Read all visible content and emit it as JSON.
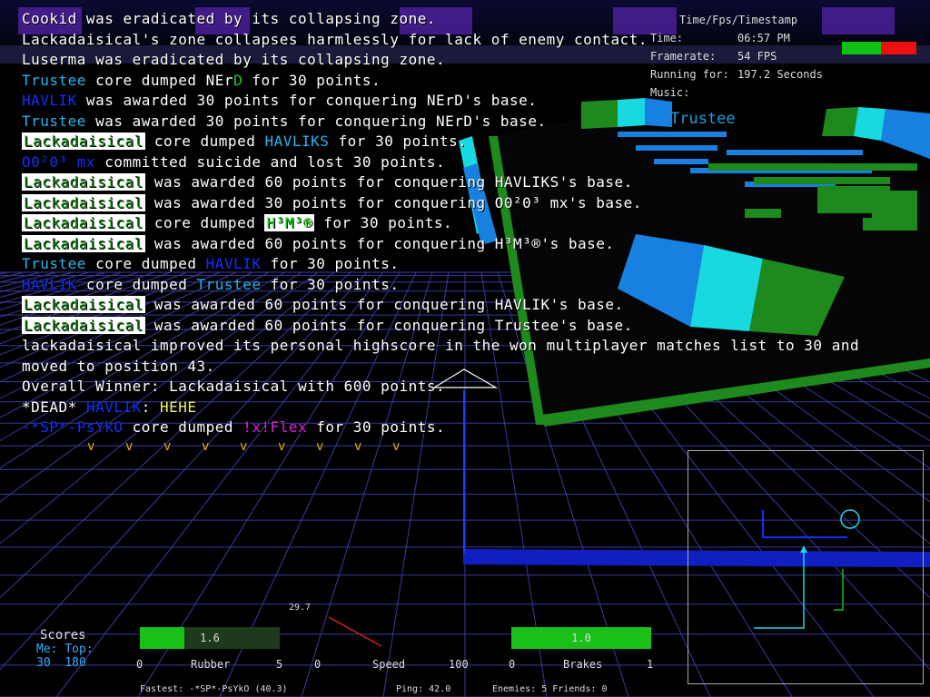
{
  "console_lines": [
    [
      {
        "t": "Cookid was eradicated by its collapsing zone.",
        "c": "#ffffff"
      }
    ],
    [
      {
        "t": "Lackadaisical's zone collapses harmlessly for lack of enemy contact.",
        "c": "#ffffff"
      }
    ],
    [
      {
        "t": "Luserma was eradicated by its collapsing zone.",
        "c": "#ffffff"
      }
    ],
    [
      {
        "t": "Trustee",
        "c": "#28b4f0"
      },
      {
        "t": " core dumped NEr",
        "c": "#ffffff"
      },
      {
        "t": "D",
        "c": "#18d018"
      },
      {
        "t": " for 30 points.",
        "c": "#ffffff"
      }
    ],
    [
      {
        "t": "HAVLIK",
        "c": "#1030ff"
      },
      {
        "t": " was awarded 30 points for conquering NErD's base.",
        "c": "#ffffff"
      }
    ],
    [
      {
        "t": "Trustee",
        "c": "#28b4f0"
      },
      {
        "t": " was awarded 30 points for conquering NErD's base.",
        "c": "#ffffff"
      }
    ],
    [
      {
        "t": "Lackadaisical",
        "c": "#0a7a0a",
        "box": true
      },
      {
        "t": " core dumped ",
        "c": "#ffffff"
      },
      {
        "t": "HAVLIKS",
        "c": "#28b4f0"
      },
      {
        "t": " for 30 points.",
        "c": "#ffffff"
      }
    ],
    [
      {
        "t": "O0²0³ mx",
        "c": "#1030ff"
      },
      {
        "t": " committed suicide and lost 30 points.",
        "c": "#ffffff"
      }
    ],
    [
      {
        "t": "Lackadaisical",
        "c": "#0a7a0a",
        "box": true
      },
      {
        "t": " was awarded 60 points for conquering HAVLIKS's base.",
        "c": "#ffffff"
      }
    ],
    [
      {
        "t": "Lackadaisical",
        "c": "#0a7a0a",
        "box": true
      },
      {
        "t": " was awarded 30 points for conquering O0²0³ mx's base.",
        "c": "#ffffff"
      }
    ],
    [
      {
        "t": "Lackadaisical",
        "c": "#0a7a0a",
        "box": true
      },
      {
        "t": " core dumped ",
        "c": "#ffffff"
      },
      {
        "t": "H³M³®",
        "c": "#18d018",
        "box": true
      },
      {
        "t": " for 30 points.",
        "c": "#ffffff"
      }
    ],
    [
      {
        "t": "Lackadaisical",
        "c": "#0a7a0a",
        "box": true
      },
      {
        "t": " was awarded 60 points for conquering H³M³®'s base.",
        "c": "#ffffff"
      }
    ],
    [
      {
        "t": "Trustee",
        "c": "#28b4f0"
      },
      {
        "t": " core dumped ",
        "c": "#ffffff"
      },
      {
        "t": "HAVLIK",
        "c": "#1030ff"
      },
      {
        "t": " for 30 points.",
        "c": "#ffffff"
      }
    ],
    [
      {
        "t": "HAVLIK",
        "c": "#1030ff"
      },
      {
        "t": " core dumped ",
        "c": "#ffffff"
      },
      {
        "t": "Trustee",
        "c": "#28b4f0"
      },
      {
        "t": " for 30 points.",
        "c": "#ffffff"
      }
    ],
    [
      {
        "t": "Lackadaisical",
        "c": "#0a7a0a",
        "box": true
      },
      {
        "t": " was awarded 60 points for conquering HAVLIK's base.",
        "c": "#ffffff"
      }
    ],
    [
      {
        "t": "Lackadaisical",
        "c": "#0a7a0a",
        "box": true
      },
      {
        "t": " was awarded 60 points for conquering Trustee's base.",
        "c": "#ffffff"
      }
    ],
    [
      {
        "t": "lackadaisical improved its personal highscore in the won multiplayer matches list to 30 and",
        "c": "#ffffff"
      }
    ],
    [
      {
        "t": "moved to position 43.",
        "c": "#ffffff"
      }
    ],
    [
      {
        "t": "Overall Winner: Lackadaisical with 600 points.",
        "c": "#ffffff"
      }
    ],
    [
      {
        "t": "*DEAD* ",
        "c": "#ffffff"
      },
      {
        "t": "HAVLIK",
        "c": "#1030ff"
      },
      {
        "t": ": ",
        "c": "#ffffff"
      },
      {
        "t": "HEHE",
        "c": "#f0f060"
      }
    ],
    [
      {
        "t": "-*SP*-PsYkO",
        "c": "#1030ff"
      },
      {
        "t": " core dumped ",
        "c": "#ffffff"
      },
      {
        "t": "!x!Flex",
        "c": "#e020e0"
      },
      {
        "t": " for 30 points.",
        "c": "#ffffff"
      }
    ]
  ],
  "hud": {
    "time_header": "Time/Fps/Timestamp",
    "time_label": "Time:",
    "time_value": "06:57 PM",
    "framerate_label": "Framerate:",
    "framerate_value": "54 FPS",
    "running_label": "Running for:",
    "running_value": "197.2 Seconds",
    "music_label": "Music:",
    "health_fraction": 0.52
  },
  "arena": {
    "player_tag": "Trustee"
  },
  "chevron_glyph": "v",
  "chevron_count": 9,
  "scores": {
    "title": "Scores",
    "me_label": "Me:",
    "top_label": "Top:",
    "me_value": "30",
    "top_value": "180"
  },
  "gauges": {
    "top_value": "29.7",
    "rubber": {
      "label": "Rubber",
      "value": "1.6",
      "min": "0",
      "max": "5",
      "fraction": 0.32
    },
    "speed": {
      "label": "Speed",
      "min": "0",
      "max": "100"
    },
    "brakes": {
      "label": "Brakes",
      "value": "1.0",
      "min": "0",
      "max": "1",
      "fraction": 1.0
    }
  },
  "status": {
    "fastest_label": "Fastest:",
    "fastest_value": "-*SP*-PsYkO (40.3)",
    "ping_label": "Ping:",
    "ping_value": "42.0",
    "enemies_label": "Enemies:",
    "enemies_value": "5",
    "friends_label": "Friends:",
    "friends_value": "0"
  },
  "colors": {
    "grid": "#3a3aa0",
    "wall_green": "#1e8a1e",
    "wall_cyan": "#18d8e0",
    "wall_blue": "#1880e0",
    "trail_blue": "#1020c0"
  }
}
